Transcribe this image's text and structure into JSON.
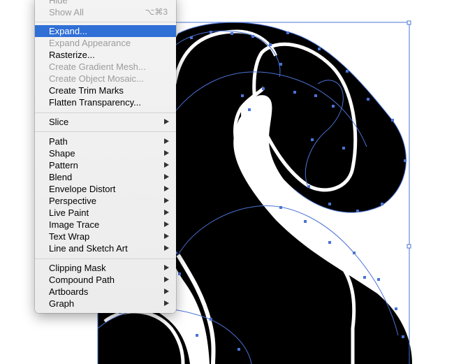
{
  "menu": {
    "top_items": [
      {
        "label": "Hide",
        "shortcut": "",
        "state": "disabled",
        "submenu": false
      },
      {
        "label": "Show All",
        "shortcut": "⌥⌘3",
        "state": "disabled",
        "submenu": false
      }
    ],
    "group_object": [
      {
        "label": "Expand...",
        "state": "highlighted",
        "submenu": false
      },
      {
        "label": "Expand Appearance",
        "state": "disabled",
        "submenu": false
      },
      {
        "label": "Rasterize...",
        "state": "enabled",
        "submenu": false
      },
      {
        "label": "Create Gradient Mesh...",
        "state": "disabled",
        "submenu": false
      },
      {
        "label": "Create Object Mosaic...",
        "state": "disabled",
        "submenu": false
      },
      {
        "label": "Create Trim Marks",
        "state": "enabled",
        "submenu": false
      },
      {
        "label": "Flatten Transparency...",
        "state": "enabled",
        "submenu": false
      }
    ],
    "group_slice": [
      {
        "label": "Slice",
        "state": "enabled",
        "submenu": true
      }
    ],
    "group_tools": [
      {
        "label": "Path",
        "state": "enabled",
        "submenu": true
      },
      {
        "label": "Shape",
        "state": "enabled",
        "submenu": true
      },
      {
        "label": "Pattern",
        "state": "enabled",
        "submenu": true
      },
      {
        "label": "Blend",
        "state": "enabled",
        "submenu": true
      },
      {
        "label": "Envelope Distort",
        "state": "enabled",
        "submenu": true
      },
      {
        "label": "Perspective",
        "state": "enabled",
        "submenu": true
      },
      {
        "label": "Live Paint",
        "state": "enabled",
        "submenu": true
      },
      {
        "label": "Image Trace",
        "state": "enabled",
        "submenu": true
      },
      {
        "label": "Text Wrap",
        "state": "enabled",
        "submenu": true
      },
      {
        "label": "Line and Sketch Art",
        "state": "enabled",
        "submenu": true
      }
    ],
    "group_masks": [
      {
        "label": "Clipping Mask",
        "state": "enabled",
        "submenu": true
      },
      {
        "label": "Compound Path",
        "state": "enabled",
        "submenu": true
      },
      {
        "label": "Artboards",
        "state": "enabled",
        "submenu": true
      },
      {
        "label": "Graph",
        "state": "enabled",
        "submenu": true
      }
    ]
  },
  "colors": {
    "highlight": "#2f6fd6",
    "path_blue": "#4a73d6",
    "art_black": "#000000",
    "menu_bg": "#efefef",
    "disabled_text": "#9c9c9c"
  },
  "icons": {
    "submenu": "triangle-right"
  }
}
